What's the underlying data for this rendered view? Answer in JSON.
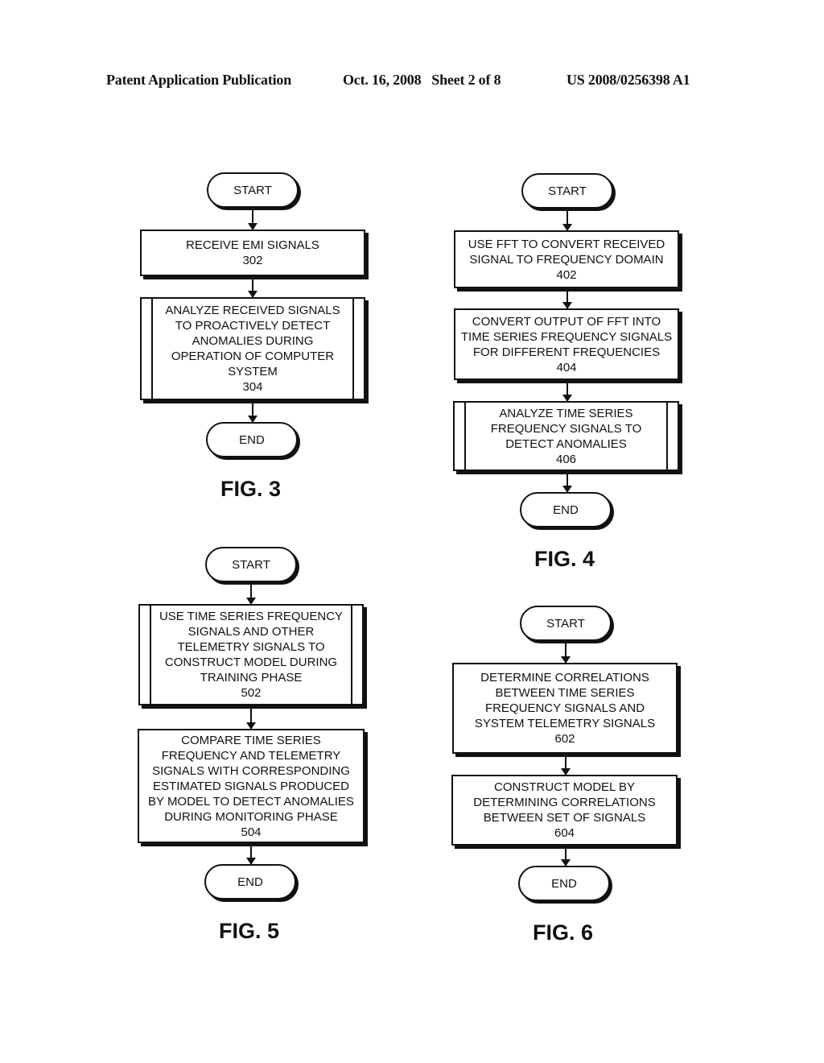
{
  "header": {
    "publication": "Patent Application Publication",
    "date_sheet": "Oct. 16, 2008   Sheet 2 of 8",
    "number": "US 2008/0256398 A1"
  },
  "figures": {
    "fig3": {
      "label": "FIG. 3",
      "start": "START",
      "end": "END",
      "steps": [
        {
          "id": "302",
          "lines": [
            "RECEIVE EMI SIGNALS"
          ],
          "type": "process"
        },
        {
          "id": "304",
          "lines": [
            "ANALYZE RECEIVED SIGNALS",
            "TO PROACTIVELY DETECT",
            "ANOMALIES DURING",
            "OPERATION OF COMPUTER",
            "SYSTEM"
          ],
          "type": "predefined-process"
        }
      ]
    },
    "fig4": {
      "label": "FIG. 4",
      "start": "START",
      "end": "END",
      "steps": [
        {
          "id": "402",
          "lines": [
            "USE FFT TO CONVERT RECEIVED",
            "SIGNAL TO FREQUENCY DOMAIN"
          ],
          "type": "process"
        },
        {
          "id": "404",
          "lines": [
            "CONVERT OUTPUT OF FFT INTO",
            "TIME SERIES FREQUENCY SIGNALS",
            "FOR DIFFERENT FREQUENCIES"
          ],
          "type": "process"
        },
        {
          "id": "406",
          "lines": [
            "ANALYZE TIME SERIES",
            "FREQUENCY SIGNALS TO",
            "DETECT ANOMALIES"
          ],
          "type": "predefined-process"
        }
      ]
    },
    "fig5": {
      "label": "FIG. 5",
      "start": "START",
      "end": "END",
      "steps": [
        {
          "id": "502",
          "lines": [
            "USE TIME SERIES FREQUENCY",
            "SIGNALS AND OTHER",
            "TELEMETRY SIGNALS TO",
            "CONSTRUCT MODEL DURING",
            "TRAINING PHASE"
          ],
          "type": "predefined-process"
        },
        {
          "id": "504",
          "lines": [
            "COMPARE TIME SERIES",
            "FREQUENCY AND TELEMETRY",
            "SIGNALS WITH CORRESPONDING",
            "ESTIMATED SIGNALS PRODUCED",
            "BY MODEL TO DETECT ANOMALIES",
            "DURING MONITORING PHASE"
          ],
          "type": "process"
        }
      ]
    },
    "fig6": {
      "label": "FIG. 6",
      "start": "START",
      "end": "END",
      "steps": [
        {
          "id": "602",
          "lines": [
            "DETERMINE CORRELATIONS",
            "BETWEEN TIME SERIES",
            "FREQUENCY SIGNALS AND",
            "SYSTEM TELEMETRY SIGNALS"
          ],
          "type": "process"
        },
        {
          "id": "604",
          "lines": [
            "CONSTRUCT MODEL BY",
            "DETERMINING CORRELATIONS",
            "BETWEEN SET OF SIGNALS"
          ],
          "type": "process"
        }
      ]
    }
  }
}
